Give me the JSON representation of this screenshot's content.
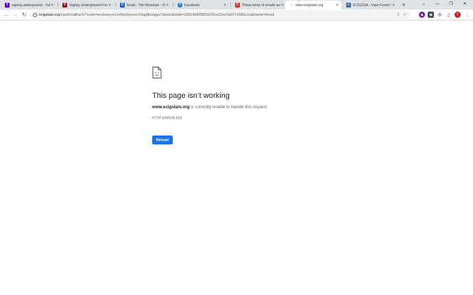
{
  "tabs": [
    {
      "title": "vaping underground - Yah",
      "icon": "yahoo-icon",
      "color": "#6001d2",
      "glyph": "Y"
    },
    {
      "title": "Vaping Underground Foru",
      "icon": "vaping-underground-icon",
      "color": "#8b1a1a",
      "glyph": "V"
    },
    {
      "title": "Email - Tim Wiseman - Ou",
      "icon": "outlook-icon",
      "color": "#0a64c8",
      "glyph": "O"
    },
    {
      "title": "Facebook",
      "icon": "facebook-icon",
      "color": "#1877f2",
      "glyph": "f"
    },
    {
      "title": "These kinds of emails are",
      "icon": "reddit-c-icon",
      "color": "#d93025",
      "glyph": "C"
    },
    {
      "title": "www.ecigstats.org",
      "icon": "globe-icon",
      "color": "#5f6368",
      "glyph": "◌"
    },
    {
      "title": "ECIGSSA - Vape Forum So",
      "icon": "ecigssa-icon",
      "color": "#3c6e9a",
      "glyph": "≡"
    }
  ],
  "active_tab_index": 5,
  "new_tab_label": "+",
  "window_controls": {
    "collapse": "⌄",
    "minimize": "—",
    "restore": "❐",
    "close": "✕"
  },
  "nav": {
    "back": "←",
    "forward": "→",
    "reload": "↻"
  },
  "address": {
    "host": "ecigstats.org",
    "path": "/oauth/callback/?code=wrubwscye1mhty2wyczzo7qqg8jxviggu7diaion&state=2d314d909853216ce22ee3a9714186e1e&iframe=break"
  },
  "extensions": {
    "avatar_letter": "T",
    "avatar_color": "#c5221f"
  },
  "error": {
    "title": "This page isn’t working",
    "host": "www.ecigstats.org",
    "message": " is currently unable to handle this request.",
    "code": "HTTP ERROR 500",
    "reload_label": "Reload"
  }
}
